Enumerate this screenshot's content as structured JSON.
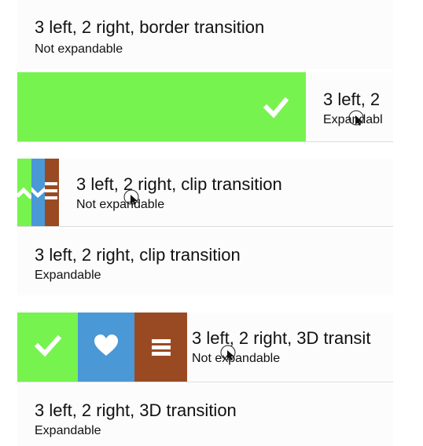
{
  "rows": [
    {
      "title": "3 left, 2 right, border transition",
      "subtitle": "Not expandable"
    },
    {
      "title": "3 left, 2",
      "subtitle": "Expandabl"
    },
    {
      "title": "3 left, 2 right, clip transition",
      "subtitle": "Not expandable"
    },
    {
      "title": "3 left, 2 right, clip transition",
      "subtitle": "Expandable"
    },
    {
      "title": "3 left, 2 right, 3D transit",
      "subtitle": "Not expandable"
    },
    {
      "title": "3 left, 2 right, 3D transition",
      "subtitle": "Expandable"
    }
  ],
  "icons": {
    "check": "checkmark-icon",
    "heart": "heart-icon",
    "menu": "menu-icon",
    "cursor": "cursor-icon"
  },
  "colors": {
    "green": "#76f34f",
    "blue": "#4a98d6",
    "brown": "#9a4a22",
    "divider": "#dcdcdc"
  }
}
